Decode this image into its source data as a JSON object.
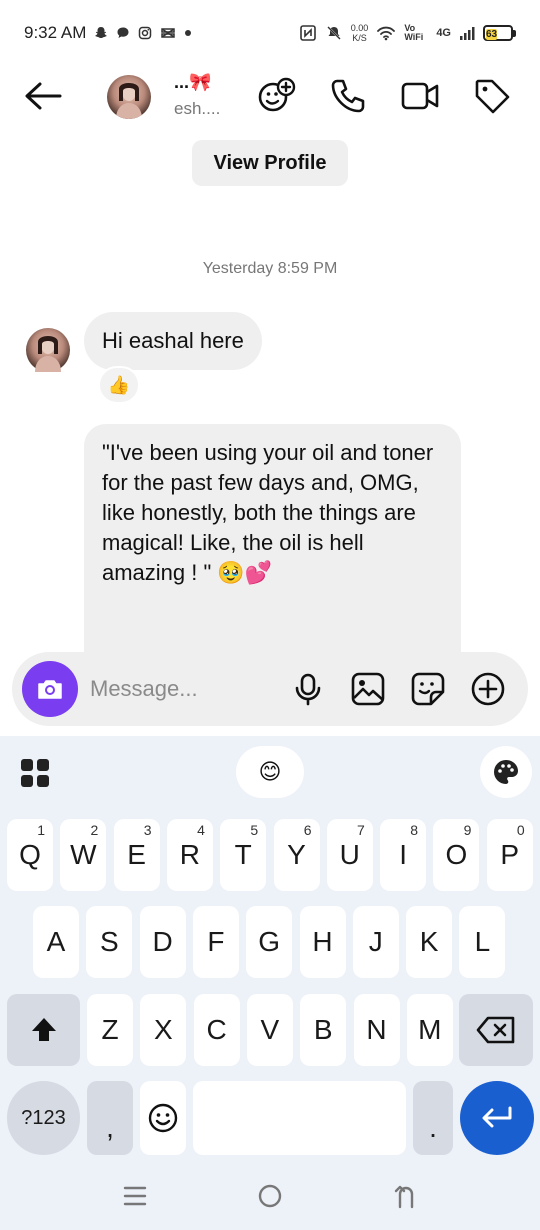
{
  "status": {
    "time": "9:32 AM",
    "left_icons": [
      "snapchat-icon",
      "chat-icon",
      "instagram-icon",
      "capcut-icon",
      "dot-icon"
    ],
    "speed_value": "0.00",
    "speed_unit": "K/S",
    "vowifi": "Vo WiFi",
    "network": "4G",
    "battery": "63",
    "battery_level": 0.63
  },
  "header": {
    "name": "...🎀",
    "subtitle": "esh...."
  },
  "view_profile": "View Profile",
  "timestamp": "Yesterday 8:59 PM",
  "messages": [
    {
      "text": "Hi eashal here",
      "reaction": "👍"
    },
    {
      "text": "\"I've been using your oil and toner for the past few days and, OMG, like honestly, both the things are magical! Like, the oil is hell amazing ! \" 🥹💕"
    }
  ],
  "composer": {
    "placeholder": "Message..."
  },
  "keyboard": {
    "emoji_key": "😊",
    "row1": [
      {
        "key": "Q",
        "hint": "1"
      },
      {
        "key": "W",
        "hint": "2"
      },
      {
        "key": "E",
        "hint": "3"
      },
      {
        "key": "R",
        "hint": "4"
      },
      {
        "key": "T",
        "hint": "5"
      },
      {
        "key": "Y",
        "hint": "6"
      },
      {
        "key": "U",
        "hint": "7"
      },
      {
        "key": "I",
        "hint": "8"
      },
      {
        "key": "O",
        "hint": "9"
      },
      {
        "key": "P",
        "hint": "0"
      }
    ],
    "row2": [
      "A",
      "S",
      "D",
      "F",
      "G",
      "H",
      "J",
      "K",
      "L"
    ],
    "row3": [
      "Z",
      "X",
      "C",
      "V",
      "B",
      "N",
      "M"
    ],
    "symbols_key": "?123",
    "comma_key": ",",
    "period_key": "."
  },
  "colors": {
    "accent": "#7a3df0",
    "enter_key": "#1a5fd0",
    "bubble": "#efefef",
    "keyboard_bg": "#edf1f8"
  }
}
